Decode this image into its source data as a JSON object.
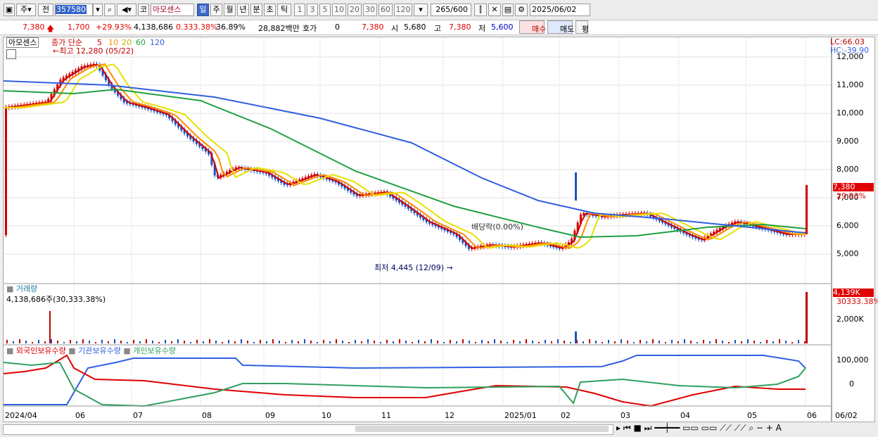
{
  "toolbar": {
    "period_label": "주",
    "prev_label": "전",
    "code": "357580",
    "market_label": "코",
    "stock_name": "아모센스",
    "period_tabs": [
      "일",
      "주",
      "월",
      "년",
      "분",
      "초",
      "틱"
    ],
    "intervals": [
      "1",
      "3",
      "5",
      "10",
      "20",
      "30",
      "60",
      "120"
    ],
    "count": "265",
    "count_total": "/600",
    "date": "2025/06/02"
  },
  "quote": {
    "price": "7,380",
    "change": "1,700",
    "change_pct": "+29.93%",
    "volume": "4,138,686",
    "vol_ratio": "0.333.38%",
    "turnover": "36.89%",
    "amount": "28,882백만",
    "hoga_label": "호가",
    "hoga_value": "0",
    "hoga_price": "7,380",
    "open_label": "시",
    "open": "5,680",
    "high_label": "고",
    "high": "7,380",
    "low_label": "저",
    "low": "5,600",
    "buy_label": "매수",
    "sell_label": "매도",
    "eval_label": "평"
  },
  "price_panel": {
    "stock_name": "아모센스",
    "ma_title": "종가 단순",
    "ma_periods": [
      "5",
      "10",
      "20",
      "60",
      "120"
    ],
    "ma_colors": [
      "#d00000",
      "#ff8c00",
      "#e8d800",
      "#20a040",
      "#3060e0"
    ],
    "high_marker": "최고 12,280 (05/22)",
    "low_marker": "최저 4,445 (12/09)",
    "dividend": "배당락(0.00%)",
    "lc": "LC:66.03",
    "hc": "HC:-39.90",
    "y_ticks": [
      "12,000",
      "11,000",
      "10,000",
      "9,000",
      "8,000",
      "7,000",
      "6,000",
      "5,000"
    ],
    "last_price": "7,380",
    "last_pct": "29.93%"
  },
  "volume_panel": {
    "title": "거래량",
    "value": "4,138,686주(30,333.38%)",
    "y_tick": "2,000K",
    "last_vol": "4,139K",
    "last_pct": "30333.38%"
  },
  "holdings_panel": {
    "series": [
      "외국인보유수량",
      "기관보유수량",
      "개인보유수량"
    ],
    "colors": [
      "#e00000",
      "#3060e0",
      "#30a060"
    ],
    "y_ticks": [
      "100,000",
      "0"
    ]
  },
  "x_axis": {
    "labels": [
      "2024/04",
      "06",
      "07",
      "08",
      "09",
      "10",
      "11",
      "12",
      "2025/01",
      "02",
      "03",
      "04",
      "05",
      "06"
    ],
    "right_label": "06/02"
  }
}
